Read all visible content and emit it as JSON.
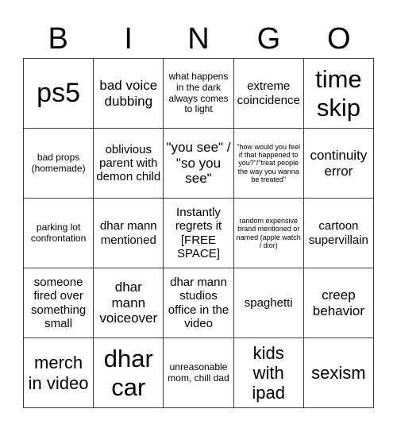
{
  "header": {
    "letters": [
      "B",
      "I",
      "N",
      "G",
      "O"
    ]
  },
  "board": {
    "rows": [
      [
        {
          "text": "ps5",
          "size": "xxxl"
        },
        {
          "text": "bad voice dubbing",
          "size": "lg"
        },
        {
          "text": "what happens in the dark always comes to light",
          "size": "sm"
        },
        {
          "text": "extreme coincidence",
          "size": "md"
        },
        {
          "text": "time skip",
          "size": "xxl"
        }
      ],
      [
        {
          "text": "bad props (homemade)",
          "size": "sm"
        },
        {
          "text": "oblivious parent with demon child",
          "size": "md"
        },
        {
          "text": "\"you see\" / \"so you see\"",
          "size": "lg"
        },
        {
          "text": "\"how would you feel if that happened to you?\"/\"treat people the way you wanna be treated\"",
          "size": "xs"
        },
        {
          "text": "continuity error",
          "size": "lg"
        }
      ],
      [
        {
          "text": "parking lot confrontation",
          "size": "sm"
        },
        {
          "text": "dhar mann mentioned",
          "size": "md"
        },
        {
          "text": "Instantly regrets it [FREE SPACE]",
          "size": "md"
        },
        {
          "text": "random expensive brand mentioned or named (apple watch / dior)",
          "size": "xs"
        },
        {
          "text": "cartoon supervillain",
          "size": "md"
        }
      ],
      [
        {
          "text": "someone fired over something small",
          "size": "md"
        },
        {
          "text": "dhar mann voiceover",
          "size": "lg"
        },
        {
          "text": "dhar mann studios office in the video",
          "size": "md"
        },
        {
          "text": "spaghetti",
          "size": "md"
        },
        {
          "text": "creep behavior",
          "size": "lg"
        }
      ],
      [
        {
          "text": "merch in video",
          "size": "xl"
        },
        {
          "text": "dhar car",
          "size": "xxl"
        },
        {
          "text": "unreasonable mom, chill dad",
          "size": "sm"
        },
        {
          "text": "kids with ipad",
          "size": "xl"
        },
        {
          "text": "sexism",
          "size": "xl"
        }
      ]
    ]
  }
}
